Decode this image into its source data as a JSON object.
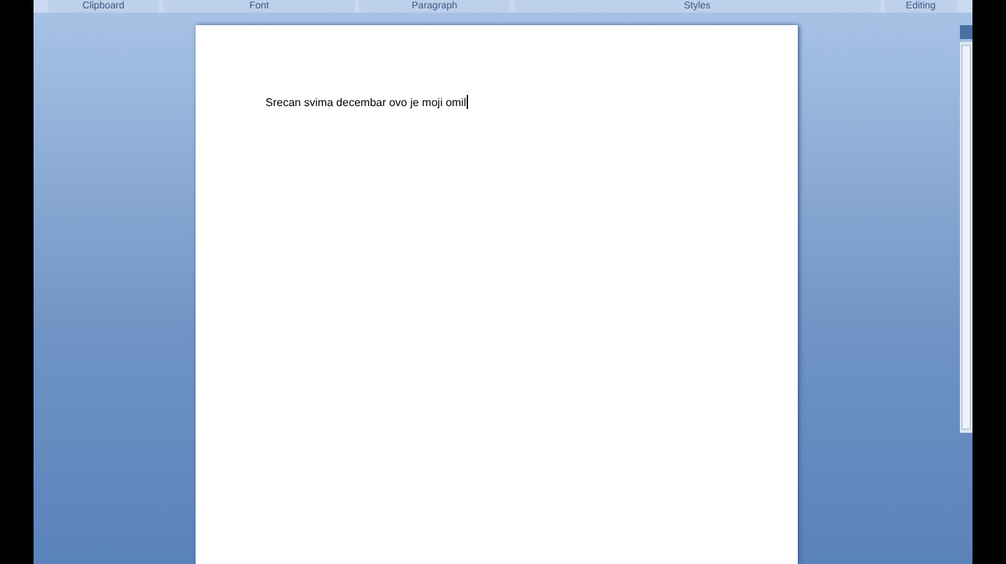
{
  "ribbon_groups": [
    {
      "label": "Clipboard"
    },
    {
      "label": "Font"
    },
    {
      "label": "Paragraph"
    },
    {
      "label": "Styles"
    },
    {
      "label": "Editing"
    }
  ],
  "document": {
    "text": "Srecan svima decembar ovo je moji omil"
  }
}
